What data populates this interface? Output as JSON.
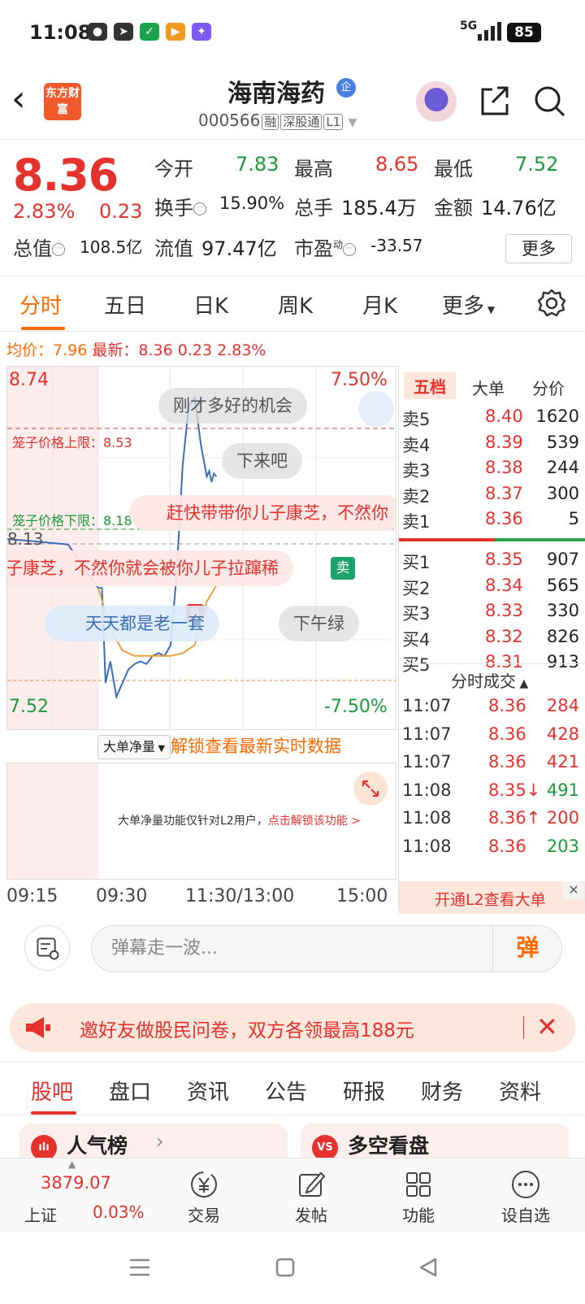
{
  "status": {
    "time": "11:08",
    "network": "5G",
    "battery": "85"
  },
  "header": {
    "logo": "东方财富",
    "stock_name": "海南海药",
    "badge": "企",
    "stock_code": "000566",
    "tags": [
      "融",
      "深股通",
      "L1"
    ]
  },
  "quote": {
    "price": "8.36",
    "change_pct": "2.83%",
    "change_amt": "0.23",
    "open_label": "今开",
    "open": "7.83",
    "high_label": "最高",
    "high": "8.65",
    "low_label": "最低",
    "low": "7.52",
    "turnover_label": "换手",
    "turnover": "15.90%",
    "volume_label": "总手",
    "volume": "185.4万",
    "amount_label": "金额",
    "amount": "14.76亿",
    "mktcap_label": "总值",
    "mktcap": "108.5亿",
    "float_label": "流值",
    "float": "97.47亿",
    "pe_label": "市盈",
    "pe_sup": "动",
    "pe": "-33.57",
    "more_label": "更多"
  },
  "chart_tabs": [
    "分时",
    "五日",
    "日K",
    "周K",
    "月K",
    "更多"
  ],
  "avg_line": {
    "avg_label": "均价：",
    "avg": "7.96",
    "latest_label": "最新：",
    "latest": "8.36",
    "chg": "0.23",
    "pct": "2.83%"
  },
  "chart": {
    "top_price": "8.74",
    "bottom_price": "7.52",
    "top_pct": "7.50%",
    "bottom_pct": "-7.50%",
    "mid_price": "8.13",
    "cage_upper": "笼子价格上限：8.53",
    "cage_lower": "笼子价格下限：8.18",
    "marker": "B",
    "danmu": [
      "刚才多好的机会",
      "下来吧",
      "赶快带带你儿子康芝，不然你",
      "子康芝，不然你就会被你儿子拉蹿稀",
      "天天都是老一套",
      "下午绿"
    ],
    "sell_tag": "卖",
    "colors": {
      "price_line": "#3a6fb7",
      "avg_line": "#e8a13a",
      "up": "#e5322d",
      "down": "#1a9a3a"
    }
  },
  "chart_data": {
    "type": "line",
    "ylim": [
      7.52,
      8.74
    ],
    "x_ticks": [
      "09:15",
      "09:30",
      "11:30/13:00",
      "15:00"
    ],
    "series": [
      {
        "name": "",
        "x": [
          "09:15",
          "09:20",
          "09:25",
          "09:30",
          "09:33",
          "09:36",
          "09:40",
          "09:45",
          "09:50",
          "09:55",
          "10:00",
          "10:05",
          "10:10",
          "10:15",
          "10:20",
          "10:25",
          "10:30",
          "10:35",
          "10:40",
          "10:45",
          "10:50",
          "10:55",
          "11:00",
          "11:02",
          "11:04",
          "11:06",
          "11:08"
        ],
        "values": [
          8.13,
          8.12,
          8.11,
          7.95,
          7.95,
          7.6,
          7.68,
          7.55,
          7.6,
          7.65,
          7.67,
          7.68,
          7.67,
          7.7,
          7.71,
          7.7,
          7.74,
          8.0,
          8.4,
          8.62,
          8.65,
          8.48,
          8.36,
          8.38,
          8.34,
          8.37,
          8.36
        ]
      },
      {
        "name": "",
        "x": [
          "09:30",
          "09:40",
          "09:50",
          "10:00",
          "10:10",
          "10:20",
          "10:30",
          "10:40",
          "10:50",
          "11:00",
          "11:08"
        ],
        "values": [
          7.95,
          7.8,
          7.72,
          7.7,
          7.7,
          7.7,
          7.7,
          7.71,
          7.74,
          7.9,
          7.96
        ]
      }
    ]
  },
  "net_flow": {
    "select": "大单净量",
    "unlock": "解锁查看最新实时数据",
    "msg": "大单净量功能仅针对L2用户，",
    "msg_link": "点击解锁该功能 >"
  },
  "time_axis": [
    "09:15",
    "09:30",
    "11:30/13:00",
    "15:00"
  ],
  "orderbook": {
    "tabs": [
      "五档",
      "大单",
      "分价"
    ],
    "sells": [
      {
        "label": "卖5",
        "price": "8.40",
        "vol": "1620"
      },
      {
        "label": "卖4",
        "price": "8.39",
        "vol": "539"
      },
      {
        "label": "卖3",
        "price": "8.38",
        "vol": "244"
      },
      {
        "label": "卖2",
        "price": "8.37",
        "vol": "300"
      },
      {
        "label": "卖1",
        "price": "8.36",
        "vol": "5"
      }
    ],
    "buys": [
      {
        "label": "买1",
        "price": "8.35",
        "vol": "907"
      },
      {
        "label": "买2",
        "price": "8.34",
        "vol": "565"
      },
      {
        "label": "买3",
        "price": "8.33",
        "vol": "330"
      },
      {
        "label": "买4",
        "price": "8.32",
        "vol": "826"
      },
      {
        "label": "买5",
        "price": "8.31",
        "vol": "913"
      }
    ],
    "trades_title": "分时成交",
    "trades": [
      {
        "time": "11:07",
        "price": "8.36",
        "vol": "284",
        "dir": "up"
      },
      {
        "time": "11:07",
        "price": "8.36",
        "vol": "428",
        "dir": "up"
      },
      {
        "time": "11:07",
        "price": "8.36",
        "vol": "421",
        "dir": "up"
      },
      {
        "time": "11:08",
        "price": "8.35↓",
        "vol": "491",
        "dir": "down"
      },
      {
        "time": "11:08",
        "price": "8.36↑",
        "vol": "200",
        "dir": "up"
      },
      {
        "time": "11:08",
        "price": "8.36",
        "vol": "203",
        "dir": "down"
      }
    ],
    "l2_promo": "开通L2查看大单"
  },
  "danmu_bar": {
    "placeholder": "弹幕走一波...",
    "send": "弹"
  },
  "promo": {
    "text": "邀好友做股民问卷，双方各领最高188元"
  },
  "section_tabs": [
    "股吧",
    "盘口",
    "资讯",
    "公告",
    "研报",
    "财务",
    "资料"
  ],
  "cards": [
    {
      "icon": "ılı",
      "title": "人气榜"
    },
    {
      "icon": "VS",
      "title": "多空看盘"
    }
  ],
  "bottom_nav": {
    "index_value": "3879.07",
    "index_name": "上证",
    "index_pct": "0.03%",
    "items": [
      "交易",
      "发帖",
      "功能",
      "设自选"
    ]
  }
}
